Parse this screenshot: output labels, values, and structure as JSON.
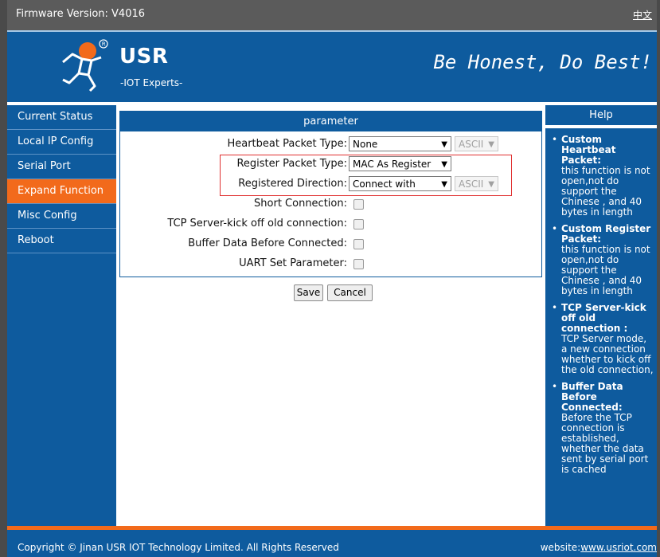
{
  "topbar": {
    "firmware": "Firmware Version:  V4016",
    "lang_link": "中文"
  },
  "banner": {
    "brand": "USR",
    "sub": "-IOT Experts-",
    "slogan": "Be Honest, Do Best!"
  },
  "sidebar": {
    "items": [
      {
        "label": "Current Status"
      },
      {
        "label": "Local IP Config"
      },
      {
        "label": "Serial Port"
      },
      {
        "label": "Expand Function"
      },
      {
        "label": "Misc Config"
      },
      {
        "label": "Reboot"
      }
    ]
  },
  "params": {
    "header": "parameter",
    "heartbeat": {
      "label": "Heartbeat Packet Type:",
      "value": "None",
      "format": "ASCII"
    },
    "register": {
      "label": "Register Packet Type:",
      "value": "MAC As Register"
    },
    "direction": {
      "label": "Registered Direction:",
      "value": "Connect with",
      "format": "ASCII"
    },
    "short_conn": {
      "label": "Short Connection:"
    },
    "kick_off": {
      "label": "TCP Server-kick off old connection:"
    },
    "buffer": {
      "label": "Buffer Data Before Connected:"
    },
    "uart": {
      "label": "UART Set Parameter:"
    }
  },
  "buttons": {
    "save": "Save",
    "cancel": "Cancel"
  },
  "help": {
    "title": "Help",
    "items": [
      {
        "title": "Custom Heartbeat Packet:",
        "text": "this function is not open,not do support the Chinese , and 40 bytes in length"
      },
      {
        "title": "Custom Register Packet:",
        "text": "this function is not open,not do support the Chinese , and 40 bytes in length"
      },
      {
        "title": "TCP Server-kick off old connection :",
        "text": "TCP Server mode, a new connection whether to kick off the old connection,"
      },
      {
        "title": "Buffer Data Before Connected:",
        "text": "Before the TCP connection is established, whether the data sent by serial port is cached"
      }
    ]
  },
  "footer": {
    "copyright": "Copyright © Jinan USR IOT Technology Limited. All Rights Reserved",
    "website_label": "website:",
    "website_link": "www.usriot.com"
  },
  "colors": {
    "primary": "#0e5b9e",
    "accent": "#f26a1b",
    "topbar": "#5b5b5b",
    "highlight": "#e03030"
  },
  "icons": {
    "logo": "usr-running-figure-logo",
    "select_arrow": "chevron-down-icon"
  }
}
